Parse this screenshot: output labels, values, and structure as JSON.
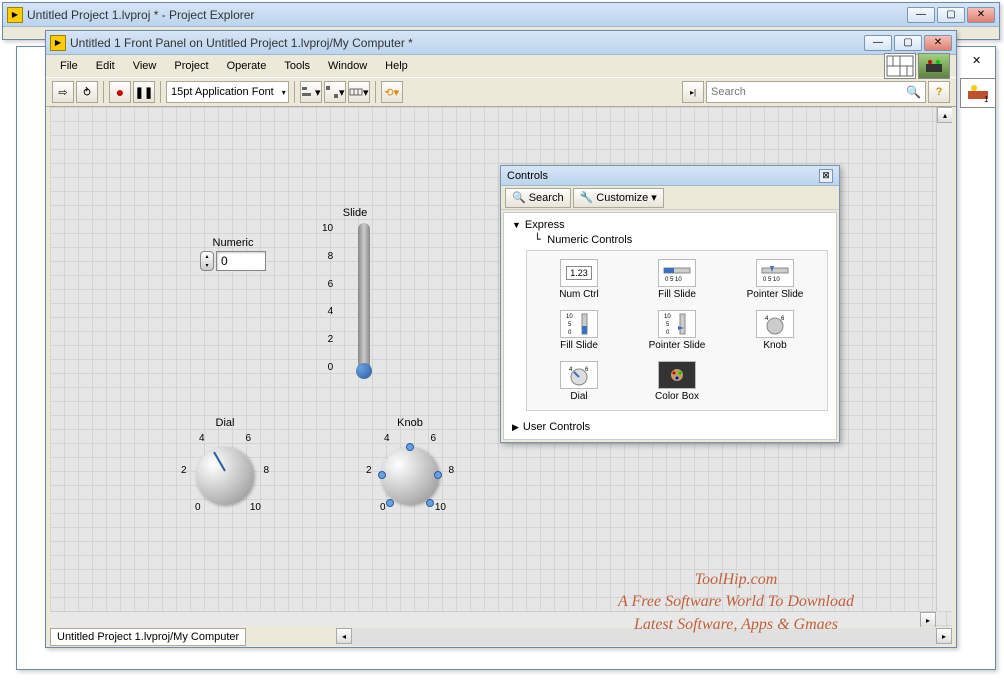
{
  "windows": {
    "back": {
      "title": "Untitled Project 1.lvproj * - Project Explorer"
    },
    "front": {
      "title": "Untitled 1 Front Panel on Untitled Project 1.lvproj/My Computer *"
    }
  },
  "menu": {
    "items": [
      "File",
      "Edit",
      "View",
      "Project",
      "Operate",
      "Tools",
      "Window",
      "Help"
    ]
  },
  "toolbar": {
    "font": "15pt Application Font",
    "search_placeholder": "Search"
  },
  "fp": {
    "numeric": {
      "label": "Numeric",
      "value": "0"
    },
    "slide": {
      "label": "Slide",
      "ticks": [
        "10",
        "8",
        "6",
        "4",
        "2",
        "0"
      ]
    },
    "dial": {
      "label": "Dial",
      "ticks": [
        "0",
        "2",
        "4",
        "6",
        "8",
        "10"
      ]
    },
    "knob": {
      "label": "Knob",
      "ticks": [
        "0",
        "2",
        "4",
        "6",
        "8",
        "10"
      ]
    }
  },
  "palette": {
    "title": "Controls",
    "search_btn": "Search",
    "customize_btn": "Customize",
    "cat_express": "Express",
    "sub_numctrl": "Numeric Controls",
    "cat_user": "User Controls",
    "items": [
      {
        "label": "Num Ctrl"
      },
      {
        "label": "Fill Slide"
      },
      {
        "label": "Pointer Slide"
      },
      {
        "label": "Fill Slide"
      },
      {
        "label": "Pointer Slide"
      },
      {
        "label": "Knob"
      },
      {
        "label": "Dial"
      },
      {
        "label": "Color Box"
      }
    ]
  },
  "footer": {
    "tab": "Untitled Project 1.lvproj/My Computer"
  },
  "watermark": {
    "line1": "ToolHip.com",
    "line2": "A Free Software World To Download",
    "line3": "Latest Software, Apps & Gmaes"
  }
}
